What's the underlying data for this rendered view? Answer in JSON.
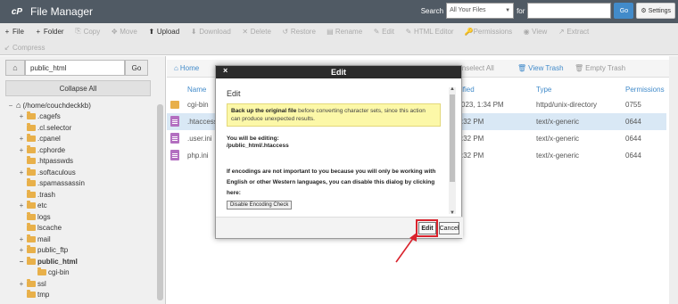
{
  "header": {
    "title": "File Manager",
    "search_label": "Search",
    "search_scope": "All Your Files",
    "for_label": "for",
    "search_value": "",
    "go_label": "Go",
    "settings_label": "Settings"
  },
  "toolbar": {
    "row1": [
      {
        "icon": "+",
        "label": "File",
        "enabled": true,
        "name": "new-file"
      },
      {
        "icon": "+",
        "label": "Folder",
        "enabled": true,
        "name": "new-folder"
      },
      {
        "icon": "⎘",
        "label": "Copy",
        "enabled": false,
        "name": "copy"
      },
      {
        "icon": "✥",
        "label": "Move",
        "enabled": false,
        "name": "move"
      },
      {
        "icon": "⬆",
        "label": "Upload",
        "enabled": true,
        "name": "upload"
      },
      {
        "icon": "⬇",
        "label": "Download",
        "enabled": false,
        "name": "download"
      },
      {
        "icon": "✕",
        "label": "Delete",
        "enabled": false,
        "name": "delete"
      },
      {
        "icon": "↺",
        "label": "Restore",
        "enabled": false,
        "name": "restore"
      },
      {
        "icon": "▤",
        "label": "Rename",
        "enabled": false,
        "name": "rename"
      },
      {
        "icon": "✎",
        "label": "Edit",
        "enabled": false,
        "name": "edit"
      },
      {
        "icon": "✎",
        "label": "HTML Editor",
        "enabled": false,
        "name": "html-editor"
      },
      {
        "icon": "🔑",
        "label": "Permissions",
        "enabled": false,
        "name": "permissions"
      },
      {
        "icon": "◉",
        "label": "View",
        "enabled": false,
        "name": "view"
      },
      {
        "icon": "↗",
        "label": "Extract",
        "enabled": false,
        "name": "extract"
      }
    ],
    "row2": [
      {
        "icon": "↙",
        "label": "Compress",
        "enabled": false,
        "name": "compress"
      }
    ]
  },
  "left": {
    "path_value": "public_html",
    "go_label": "Go",
    "collapse_label": "Collapse All",
    "tree": [
      {
        "toggle": "−",
        "label": "(/home/couchdeckkb)",
        "home": true,
        "indent": 0,
        "bold": false
      },
      {
        "toggle": "+",
        "label": ".cagefs",
        "indent": 1,
        "bold": false
      },
      {
        "toggle": "",
        "label": ".cl.selector",
        "indent": 1,
        "bold": false
      },
      {
        "toggle": "+",
        "label": ".cpanel",
        "indent": 1,
        "bold": false
      },
      {
        "toggle": "+",
        "label": ".cphorde",
        "indent": 1,
        "bold": false
      },
      {
        "toggle": "",
        "label": ".htpasswds",
        "indent": 1,
        "bold": false
      },
      {
        "toggle": "+",
        "label": ".softaculous",
        "indent": 1,
        "bold": false
      },
      {
        "toggle": "",
        "label": ".spamassassin",
        "indent": 1,
        "bold": false
      },
      {
        "toggle": "",
        "label": ".trash",
        "indent": 1,
        "bold": false
      },
      {
        "toggle": "+",
        "label": "etc",
        "indent": 1,
        "bold": false
      },
      {
        "toggle": "",
        "label": "logs",
        "indent": 1,
        "bold": false
      },
      {
        "toggle": "",
        "label": "lscache",
        "indent": 1,
        "bold": false
      },
      {
        "toggle": "+",
        "label": "mail",
        "indent": 1,
        "bold": false
      },
      {
        "toggle": "+",
        "label": "public_ftp",
        "indent": 1,
        "bold": false
      },
      {
        "toggle": "−",
        "label": "public_html",
        "indent": 1,
        "bold": true
      },
      {
        "toggle": "",
        "label": "cgi-bin",
        "indent": 2,
        "bold": false
      },
      {
        "toggle": "+",
        "label": "ssl",
        "indent": 1,
        "bold": false
      },
      {
        "toggle": "",
        "label": "tmp",
        "indent": 1,
        "bold": false
      }
    ]
  },
  "right": {
    "home_label": "Home",
    "unselect_label": "Unselect All",
    "view_trash_label": "View Trash",
    "empty_trash_label": "Empty Trash",
    "columns": {
      "name": "Name",
      "modified": "ified",
      "type": "Type",
      "permissions": "Permissions"
    },
    "files": [
      {
        "name": "cgi-bin",
        "kind": "folder",
        "modified": "023, 1:34 PM",
        "type": "httpd/unix-directory",
        "perms": "0755",
        "selected": false
      },
      {
        "name": ".htaccess",
        "kind": "doc",
        "modified": ":32 PM",
        "type": "text/x-generic",
        "perms": "0644",
        "selected": true
      },
      {
        "name": ".user.ini",
        "kind": "doc",
        "modified": ":32 PM",
        "type": "text/x-generic",
        "perms": "0644",
        "selected": false
      },
      {
        "name": "php.ini",
        "kind": "doc",
        "modified": ":32 PM",
        "type": "text/x-generic",
        "perms": "0644",
        "selected": false
      }
    ]
  },
  "modal": {
    "title": "Edit",
    "close_glyph": "×",
    "heading": "Edit",
    "warn_bold": "Back up the original file",
    "warn_rest": " before converting character sets, since this action can produce unexpected results.",
    "editing_label": "You will be editing:",
    "editing_path": "/public_html/.htaccess",
    "encoding_text": "If encodings are not important to you because you will only be working with English or other Western languages, you can disable this dialog by clicking here:",
    "disable_btn_label": "Disable Encoding Check",
    "edit_btn_label": "Edit",
    "cancel_btn_label": "Cancel"
  },
  "colors": {
    "header_bg": "#505a64",
    "link_blue": "#428bca",
    "highlight_red": "#d9232d",
    "folder": "#e8b04a",
    "doc": "#b36fc0"
  }
}
